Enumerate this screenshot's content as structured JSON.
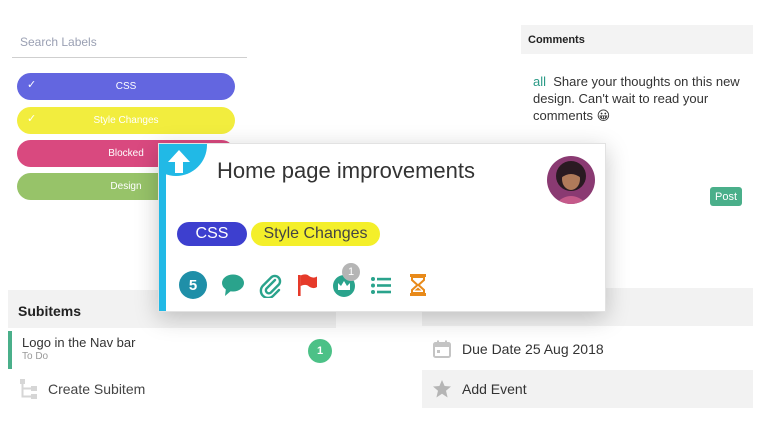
{
  "labels": {
    "search_placeholder": "Search Labels",
    "items": [
      {
        "text": "CSS",
        "color": "#6366e0",
        "checked": true
      },
      {
        "text": "Style Changes",
        "color": "#f2ed3e",
        "checked": true
      },
      {
        "text": "Blocked",
        "color": "#d9497f",
        "checked": false
      },
      {
        "text": "Design",
        "color": "#97c369",
        "checked": false
      }
    ]
  },
  "comments": {
    "header": "Comments",
    "mention": "all",
    "body": "Share your thoughts on this new design. Can't wait to read your comments 😀",
    "post_label": "Post"
  },
  "card": {
    "title": "Home page improvements",
    "tags": [
      {
        "text": "CSS",
        "color": "#3d3fcf"
      },
      {
        "text": "Style Changes",
        "color": "#f4ef2a"
      }
    ],
    "subitem_count": "5",
    "crown_badge": "1",
    "icons": [
      "upload-arrow-icon",
      "comment-icon",
      "paperclip-icon",
      "flag-icon",
      "crown-icon",
      "list-icon",
      "hourglass-icon"
    ],
    "accent": "#21b9e6"
  },
  "subitems": {
    "header": "Subitems",
    "items": [
      {
        "title": "Logo in the Nav bar",
        "status": "To Do",
        "count": "1"
      }
    ],
    "create_label": "Create Subitem"
  },
  "details": {
    "due_date": "Due Date 25 Aug 2018",
    "add_event": "Add Event"
  }
}
